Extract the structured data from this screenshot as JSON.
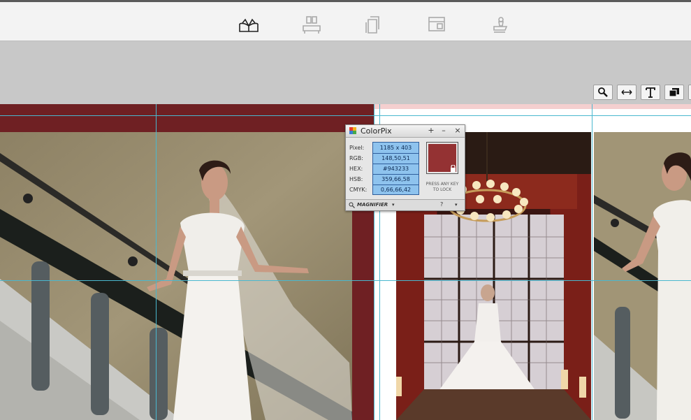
{
  "toolbar": {
    "items": [
      {
        "name": "book-icon",
        "selected": true
      },
      {
        "name": "spread-layout-icon",
        "selected": false
      },
      {
        "name": "pages-icon",
        "selected": false
      },
      {
        "name": "layout-template-icon",
        "selected": false
      },
      {
        "name": "stamp-icon",
        "selected": false
      }
    ]
  },
  "canvas_tools": [
    "magnifier-icon",
    "fit-width-icon",
    "text-icon",
    "layers-icon"
  ],
  "colorpix": {
    "title": "ColorPix",
    "controls": {
      "add": "+",
      "minimize": "–",
      "close": "×"
    },
    "labels": {
      "pixel": "Pixel:",
      "rgb": "RGB:",
      "hex": "HEX:",
      "hsb": "HSB:",
      "cmyk": "CMYK:"
    },
    "values": {
      "pixel": "1185 x 403",
      "rgb": "148,50,51",
      "hex": "#943233",
      "hsb": "359,66,58",
      "cmyk": "0,66,66,42"
    },
    "swatch_color": "#943233",
    "hint": "PRESS ANY KEY TO LOCK",
    "mode": "MAGNIFIER",
    "help": "?"
  },
  "colors": {
    "spread_background": "#6f2023",
    "guide": "#49b8cf"
  }
}
